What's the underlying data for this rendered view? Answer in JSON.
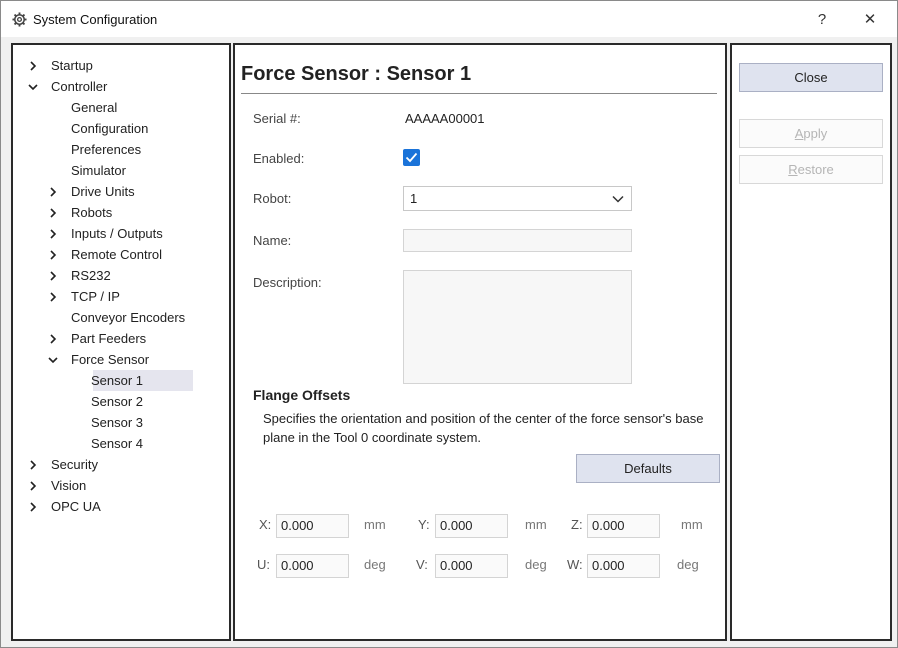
{
  "window": {
    "title": "System Configuration",
    "help_label": "?",
    "close_glyph": "✕"
  },
  "tree": {
    "items": [
      {
        "label": "Startup",
        "expander": "right"
      },
      {
        "label": "Controller",
        "expander": "down"
      },
      {
        "label": "General"
      },
      {
        "label": "Configuration"
      },
      {
        "label": "Preferences"
      },
      {
        "label": "Simulator"
      },
      {
        "label": "Drive Units",
        "expander": "right"
      },
      {
        "label": "Robots",
        "expander": "right"
      },
      {
        "label": "Inputs / Outputs",
        "expander": "right"
      },
      {
        "label": "Remote Control",
        "expander": "right"
      },
      {
        "label": "RS232",
        "expander": "right"
      },
      {
        "label": "TCP / IP",
        "expander": "right"
      },
      {
        "label": "Conveyor Encoders"
      },
      {
        "label": "Part Feeders",
        "expander": "right"
      },
      {
        "label": "Force Sensor",
        "expander": "down"
      },
      {
        "label": "Sensor 1",
        "selected": true
      },
      {
        "label": "Sensor 2"
      },
      {
        "label": "Sensor 3"
      },
      {
        "label": "Sensor 4"
      },
      {
        "label": "Security",
        "expander": "right"
      },
      {
        "label": "Vision",
        "expander": "right"
      },
      {
        "label": "OPC UA",
        "expander": "right"
      }
    ]
  },
  "main": {
    "title": "Force Sensor : Sensor 1",
    "serial_label": "Serial #:",
    "serial_value": "AAAAA00001",
    "enabled_label": "Enabled:",
    "enabled_checked": true,
    "robot_label": "Robot:",
    "robot_value": "1",
    "name_label": "Name:",
    "name_value": "",
    "description_label": "Description:",
    "description_value": "",
    "flange": {
      "title": "Flange Offsets",
      "description": "Specifies the orientation and position of the center of the force sensor's base plane in the Tool 0 coordinate system.",
      "defaults_label": "Defaults",
      "offsets": {
        "x": {
          "label": "X:",
          "value": "0.000",
          "unit": "mm"
        },
        "y": {
          "label": "Y:",
          "value": "0.000",
          "unit": "mm"
        },
        "z": {
          "label": "Z:",
          "value": "0.000",
          "unit": "mm"
        },
        "u": {
          "label": "U:",
          "value": "0.000",
          "unit": "deg"
        },
        "v": {
          "label": "V:",
          "value": "0.000",
          "unit": "deg"
        },
        "w": {
          "label": "W:",
          "value": "0.000",
          "unit": "deg"
        }
      }
    }
  },
  "actions": {
    "close_label": "Close",
    "apply_label": "Apply",
    "restore_label": "Restore"
  },
  "colors": {
    "accent": "#1a73d9",
    "button_bg": "#dfe3ef",
    "selection_bg": "#e5e5ee"
  }
}
